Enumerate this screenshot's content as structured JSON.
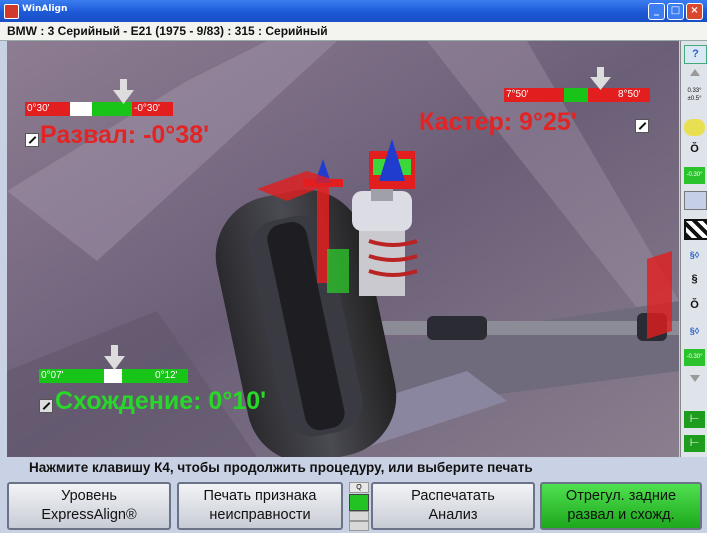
{
  "window": {
    "title": "WinAlign"
  },
  "vehicle": {
    "line": "BMW : 3 Серийный - E21 (1975 - 9/83) : 315 : Серийный"
  },
  "camber": {
    "min": "0°30'",
    "max": "-0°30'",
    "label": "Развал: -0°38'",
    "color": "#e32424"
  },
  "caster": {
    "min": "7°50'",
    "max": "8°50'",
    "label": "Кастер: 9°25'",
    "color": "#e32424"
  },
  "toe": {
    "min": "0°07'",
    "max": "0°12'",
    "label": "Схождение: 0°10'",
    "color": "#28d828"
  },
  "sidebar": {
    "items": [
      {
        "icon": "help-icon",
        "text": "?"
      },
      {
        "icon": "spec-value-icon",
        "text": "0.33° ±0.5°"
      },
      {
        "icon": "caster-swing-icon",
        "text": ""
      },
      {
        "icon": "turn-icon",
        "text": ""
      },
      {
        "icon": "readings-icon",
        "text": "-0.30°"
      },
      {
        "icon": "print-icon",
        "text": ""
      },
      {
        "icon": "checkered-flag-icon",
        "text": ""
      },
      {
        "icon": "adjust-icon",
        "text": ""
      },
      {
        "icon": "readings-icon-2",
        "text": "-0.30°"
      },
      {
        "icon": "wheel-left-icon",
        "text": ""
      },
      {
        "icon": "wheel-right-icon",
        "text": ""
      }
    ]
  },
  "status": {
    "message": "Нажмите клавишу К4, чтобы продолжить процедуру, или выберите печать"
  },
  "buttons": {
    "b1_line1": "Уровень",
    "b1_line2": "ExpressAlign®",
    "b2_line1": "Печать признака",
    "b2_line2": "неисправности",
    "b3_line1": "Распечатать",
    "b3_line2": "Анализ",
    "b4_line1": "Отрегул. задние",
    "b4_line2": "развал и схожд."
  },
  "colors": {
    "accent_green": "#22c322",
    "alert_red": "#e21e1e",
    "titlebar": "#1d59d6"
  }
}
